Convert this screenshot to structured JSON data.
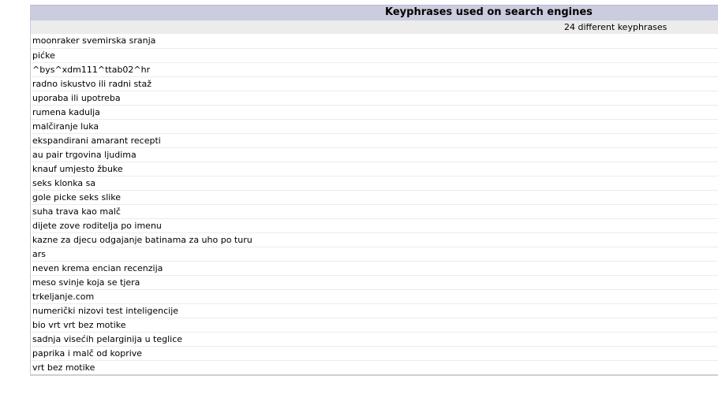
{
  "header": {
    "title": "Keyphrases used on search engines",
    "summary": "24 different keyphrases"
  },
  "keyphrases": [
    "moonraker svemirska sranja",
    "pićke",
    "^bys^xdm111^ttab02^hr",
    "radno iskustvo ili radni staž",
    "uporaba ili upotreba",
    "rumena kadulja",
    "malčiranje luka",
    "ekspandirani amarant recepti",
    "au pair trgovina ljudima",
    "knauf umjesto žbuke",
    "seks klonka sa",
    "gole picke seks slike",
    "suha trava kao malč",
    "dijete zove roditelja po imenu",
    "kazne za djecu odgajanje batinama za uho po turu",
    "ars",
    "neven krema encian recenzija",
    "meso svinje koja se tjera",
    "trkeljanje.com",
    "numerički nizovi test inteligencije",
    "bio vrt vrt bez motike",
    "sadnja visećih pelarginija u teglice",
    "paprika i malč od koprive",
    "vrt bez motike"
  ]
}
